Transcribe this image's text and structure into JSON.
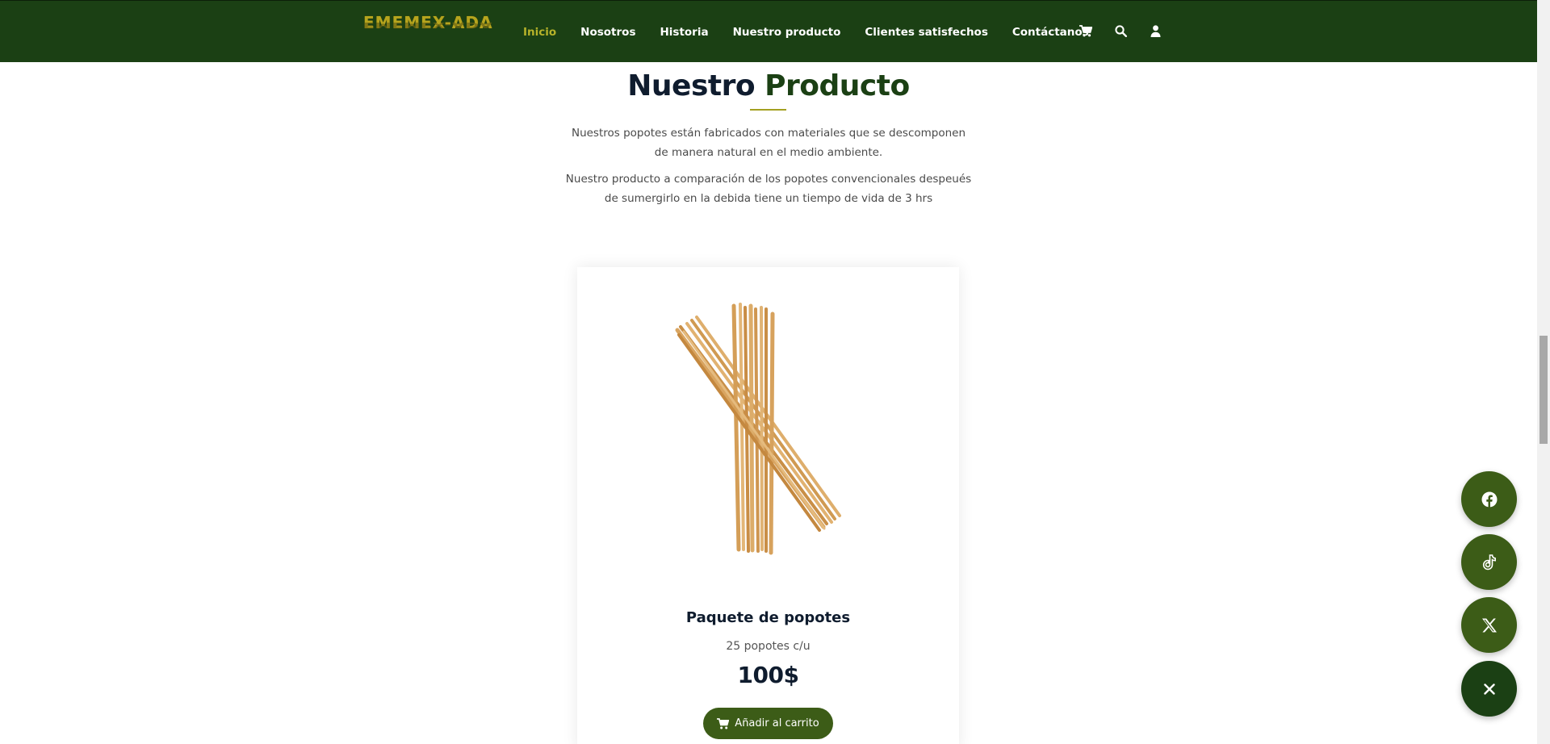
{
  "header": {
    "logo_text": "EMEMEX-ADA",
    "nav": [
      {
        "label": "Inicio",
        "active": true
      },
      {
        "label": "Nosotros"
      },
      {
        "label": "Historia"
      },
      {
        "label": "Nuestro producto"
      },
      {
        "label": "Clientes satisfechos"
      },
      {
        "label": "Contáctanos"
      }
    ],
    "icons": [
      "cart-icon",
      "search-icon",
      "user-icon"
    ]
  },
  "section": {
    "title_main": "Nuestro",
    "title_accent": "Producto",
    "desc1": "Nuestros popotes están fabricados con materiales que se descomponen de manera natural en el medio ambiente.",
    "desc2": "Nuestro producto a comparación de los popotes convencionales despeués de sumergirlo en la debida tiene un tiempo de vida de 3 hrs"
  },
  "product": {
    "name": "Paquete de popotes",
    "description": "25 popotes c/u",
    "price": "100$",
    "add_to_cart": "Añadir al carrito"
  },
  "social": [
    "facebook-icon",
    "tiktok-icon",
    "x-icon",
    "close-icon"
  ],
  "colors": {
    "navbar": "#1b4014",
    "accent": "#b6b22a",
    "button": "#3c5c17",
    "title": "#0f1c2e"
  }
}
